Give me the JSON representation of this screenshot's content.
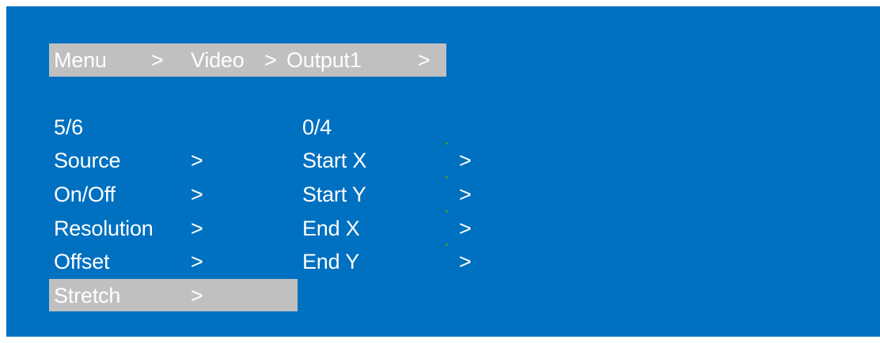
{
  "breadcrumb": {
    "menu": "Menu",
    "sep1": ">",
    "video": "Video",
    "sep2": ">",
    "output": "Output1",
    "sep3": ">"
  },
  "left_menu": {
    "counter": "5/6",
    "items": [
      {
        "label": "Source",
        "arrow": ">"
      },
      {
        "label": "On/Off",
        "arrow": ">"
      },
      {
        "label": "Resolution",
        "arrow": ">"
      },
      {
        "label": "Offset",
        "arrow": ">"
      },
      {
        "label": "Stretch",
        "arrow": ">",
        "selected": true
      }
    ]
  },
  "right_menu": {
    "counter": "0/4",
    "items": [
      {
        "label": "Start X",
        "arrow": ">"
      },
      {
        "label": "Start Y",
        "arrow": ">"
      },
      {
        "label": "End X",
        "arrow": ">"
      },
      {
        "label": "End Y",
        "arrow": ">"
      }
    ]
  },
  "colors": {
    "background": "#0070c0",
    "highlight": "#c0c0c0",
    "text": "#ffffff",
    "marker": "#3a9a3a"
  }
}
